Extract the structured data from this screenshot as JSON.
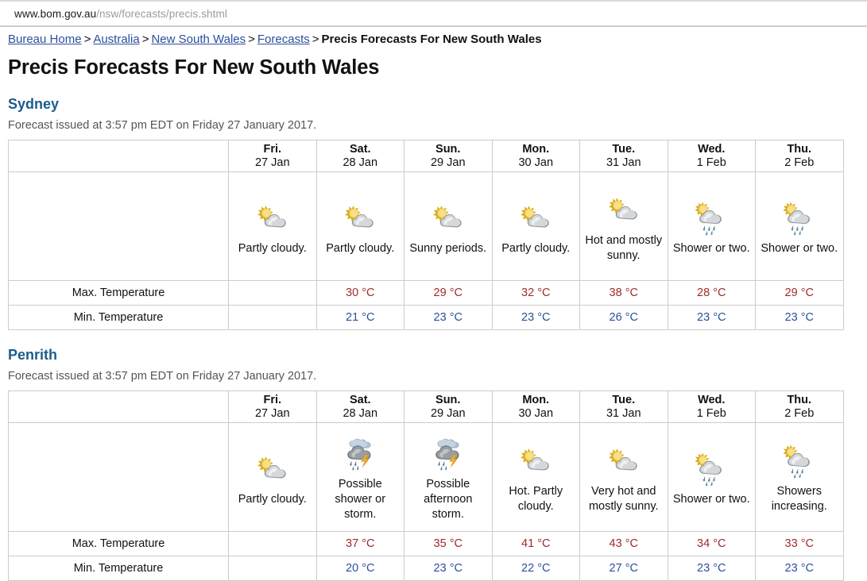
{
  "browser": {
    "url_host": "www.bom.gov.au",
    "url_path": "/nsw/forecasts/precis.shtml"
  },
  "breadcrumb": {
    "items": [
      {
        "label": "Bureau Home",
        "link": true
      },
      {
        "label": "Australia",
        "link": true
      },
      {
        "label": "New South Wales",
        "link": true
      },
      {
        "label": "Forecasts",
        "link": true
      },
      {
        "label": "Precis Forecasts For New South Wales",
        "link": false
      }
    ],
    "separator": ">"
  },
  "page": {
    "title": "Precis Forecasts For New South Wales"
  },
  "colors": {
    "heading_blue": "#1b5c8c",
    "link_blue": "#2b4f9e",
    "max_temp_red": "#9e2a2a",
    "min_temp_blue": "#2b4f9e",
    "table_border": "#cccccc",
    "issued_gray": "#555555"
  },
  "row_labels": {
    "max": "Max. Temperature",
    "min": "Min. Temperature"
  },
  "days": [
    {
      "dow": "Fri.",
      "date": "27 Jan"
    },
    {
      "dow": "Sat.",
      "date": "28 Jan"
    },
    {
      "dow": "Sun.",
      "date": "29 Jan"
    },
    {
      "dow": "Mon.",
      "date": "30 Jan"
    },
    {
      "dow": "Tue.",
      "date": "31 Jan"
    },
    {
      "dow": "Wed.",
      "date": "1 Feb"
    },
    {
      "dow": "Thu.",
      "date": "2 Feb"
    }
  ],
  "locations": [
    {
      "name": "Sydney",
      "issued": "Forecast issued at 3:57 pm EDT on Friday 27 January 2017.",
      "forecasts": [
        {
          "icon": "sun-cloud-icon",
          "desc": "Partly cloudy.",
          "max": "",
          "min": ""
        },
        {
          "icon": "sun-cloud-icon",
          "desc": "Partly cloudy.",
          "max": "30 °C",
          "min": "21 °C"
        },
        {
          "icon": "sun-cloud-icon",
          "desc": "Sunny periods.",
          "max": "29 °C",
          "min": "23 °C"
        },
        {
          "icon": "sun-cloud-icon",
          "desc": "Partly cloudy.",
          "max": "32 °C",
          "min": "23 °C"
        },
        {
          "icon": "sun-cloud-icon",
          "desc": "Hot and mostly sunny.",
          "max": "38 °C",
          "min": "26 °C"
        },
        {
          "icon": "sun-cloud-rain-icon",
          "desc": "Shower or two.",
          "max": "28 °C",
          "min": "23 °C"
        },
        {
          "icon": "sun-cloud-rain-icon",
          "desc": "Shower or two.",
          "max": "29 °C",
          "min": "23 °C"
        }
      ]
    },
    {
      "name": "Penrith",
      "issued": "Forecast issued at 3:57 pm EDT on Friday 27 January 2017.",
      "forecasts": [
        {
          "icon": "sun-cloud-icon",
          "desc": "Partly cloudy.",
          "max": "",
          "min": ""
        },
        {
          "icon": "storm-icon",
          "desc": "Possible shower or storm.",
          "max": "37 °C",
          "min": "20 °C"
        },
        {
          "icon": "storm-icon",
          "desc": "Possible afternoon storm.",
          "max": "35 °C",
          "min": "23 °C"
        },
        {
          "icon": "sun-cloud-icon",
          "desc": "Hot. Partly cloudy.",
          "max": "41 °C",
          "min": "22 °C"
        },
        {
          "icon": "sun-cloud-icon",
          "desc": "Very hot and mostly sunny.",
          "max": "43 °C",
          "min": "27 °C"
        },
        {
          "icon": "sun-cloud-rain-icon",
          "desc": "Shower or two.",
          "max": "34 °C",
          "min": "23 °C"
        },
        {
          "icon": "sun-cloud-rain-icon",
          "desc": "Showers increasing.",
          "max": "33 °C",
          "min": "23 °C"
        }
      ]
    }
  ]
}
